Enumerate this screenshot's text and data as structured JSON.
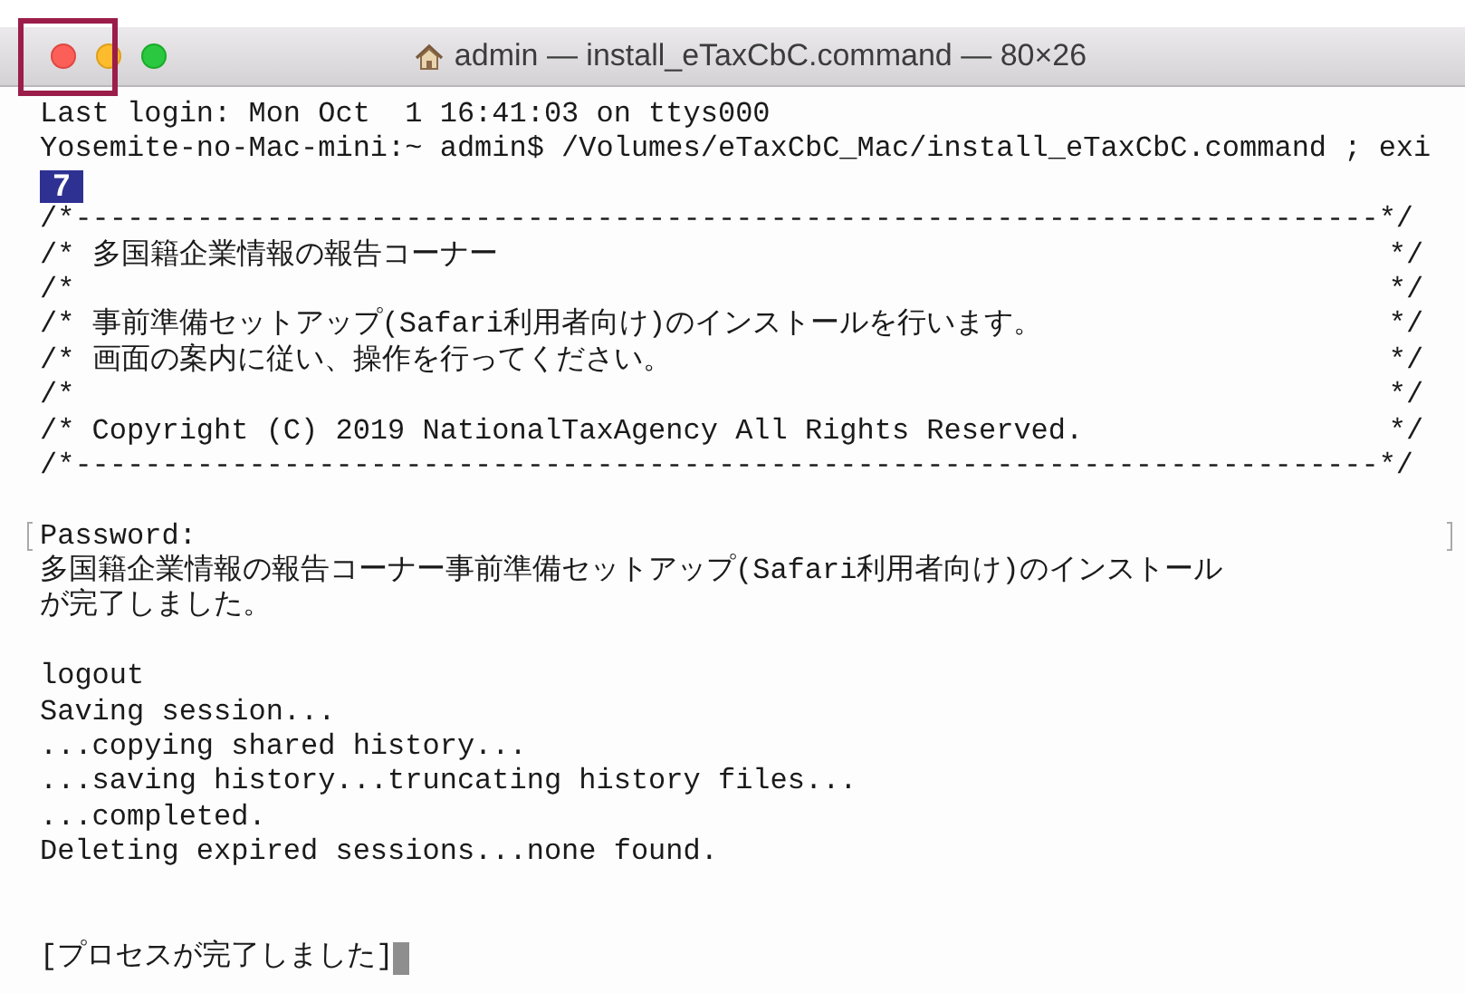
{
  "window": {
    "title": "admin — install_eTaxCbC.command — 80×26",
    "buttons": [
      {
        "kind": "close"
      },
      {
        "kind": "minimize"
      },
      {
        "kind": "zoom"
      }
    ]
  },
  "annotation": {
    "highlight_frame": true,
    "step_badge": "7"
  },
  "lines": [
    {
      "kind": "text",
      "text": "Last login: Mon Oct  1 16:41:03 on ttys000"
    },
    {
      "kind": "text",
      "text": "Yosemite-no-Mac-mini:~ admin$ /Volumes/eTaxCbC_Mac/install_eTaxCbC.command ; exi"
    },
    {
      "kind": "blank"
    },
    {
      "kind": "text",
      "text": "/*---------------------------------------------------------------------------*/"
    },
    {
      "kind": "boxed",
      "text": "/* 多国籍企業情報の報告コーナー",
      "right": "*/"
    },
    {
      "kind": "boxed",
      "text": "/*",
      "right": "*/"
    },
    {
      "kind": "boxed",
      "text": "/* 事前準備セットアップ(Safari利用者向け)のインストールを行います。",
      "right": "*/"
    },
    {
      "kind": "boxed",
      "text": "/* 画面の案内に従い、操作を行ってください。",
      "right": "*/"
    },
    {
      "kind": "boxed",
      "text": "/*",
      "right": "*/"
    },
    {
      "kind": "boxed",
      "text": "/* Copyright (C) 2019 NationalTaxAgency All Rights Reserved.",
      "right": "*/"
    },
    {
      "kind": "text",
      "text": "/*---------------------------------------------------------------------------*/"
    },
    {
      "kind": "blank"
    },
    {
      "kind": "marked",
      "text": "Password:"
    },
    {
      "kind": "text",
      "text": "多国籍企業情報の報告コーナー事前準備セットアップ(Safari利用者向け)のインストール"
    },
    {
      "kind": "text",
      "text": "が完了しました。"
    },
    {
      "kind": "blank"
    },
    {
      "kind": "text",
      "text": "logout"
    },
    {
      "kind": "text",
      "text": "Saving session..."
    },
    {
      "kind": "text",
      "text": "...copying shared history..."
    },
    {
      "kind": "text",
      "text": "...saving history...truncating history files..."
    },
    {
      "kind": "text",
      "text": "...completed."
    },
    {
      "kind": "text",
      "text": "Deleting expired sessions...none found."
    },
    {
      "kind": "blank"
    },
    {
      "kind": "blank"
    },
    {
      "kind": "prompt",
      "text": "[プロセスが完了しました]"
    }
  ],
  "cursor": true
}
